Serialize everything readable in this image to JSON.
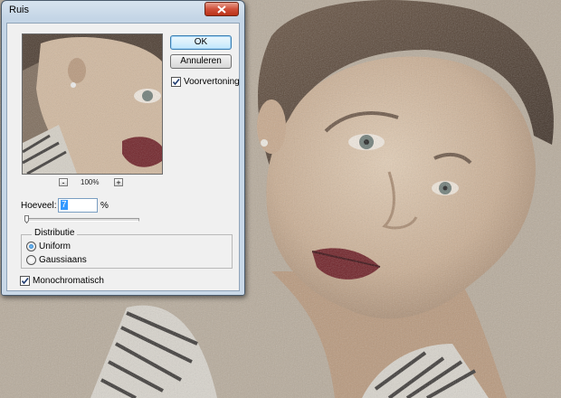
{
  "dialog": {
    "title": "Ruis",
    "ok_label": "OK",
    "cancel_label": "Annuleren",
    "preview_label": "Voorvertoning",
    "preview_checked": true,
    "zoom_out_label": "-",
    "zoom_in_label": "+",
    "zoom_level": "100%",
    "amount_label": "Hoeveel:",
    "amount_value": "7",
    "amount_unit": "%",
    "distribution_title": "Distributie",
    "distribution_options": [
      "Uniform",
      "Gaussiaans"
    ],
    "distribution_selected": "Uniform",
    "monochrome_label": "Monochromatisch",
    "monochrome_checked": true
  },
  "colors": {
    "accent": "#3399ff",
    "close_button": "#c94a32",
    "photo_background": "#b9ad9d"
  },
  "icons": [
    "close-icon",
    "checkmark-icon"
  ]
}
